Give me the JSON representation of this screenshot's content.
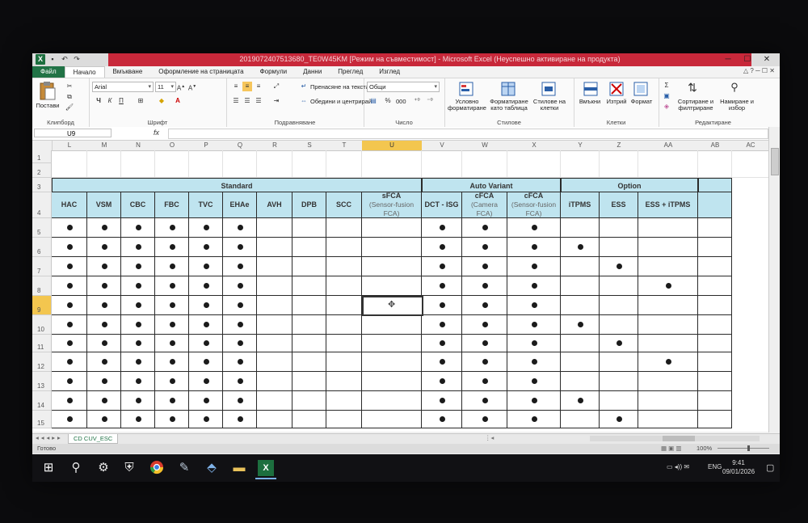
{
  "window": {
    "title": "2019072407513680_TE0W45KM [Режим на съвместимост] - Microsoft Excel (Неуспешно активиране на продукта)",
    "quick_access": [
      "save-icon",
      "undo-icon",
      "redo-icon"
    ],
    "controls": [
      "─",
      "☐",
      "✕"
    ]
  },
  "ribbon_tabs": [
    "Файл",
    "Начало",
    "Вмъкване",
    "Оформление на страницата",
    "Формули",
    "Данни",
    "Преглед",
    "Изглед"
  ],
  "ribbon": {
    "clipboard": {
      "paste": "Постави",
      "label": "Клипборд"
    },
    "font": {
      "name": "Arial",
      "size": "11",
      "label": "Шрифт",
      "bold": "Ч",
      "italic": "К",
      "underline": "П"
    },
    "alignment": {
      "wrap": "Пренасяне на текста",
      "merge": "Обедини и центрирай",
      "label": "Подравняване"
    },
    "number": {
      "format": "Общи",
      "label": "Число",
      "percent": "%",
      "thousands": "000"
    },
    "styles": {
      "cond": "Условно форматиране",
      "table": "Форматиране като таблица",
      "cell": "Стилове на клетки",
      "label": "Стилове"
    },
    "cells": {
      "insert": "Вмъкни",
      "delete": "Изтрий",
      "format": "Формат",
      "label": "Клетки"
    },
    "editing": {
      "sort": "Сортиране и филтриране",
      "find": "Намиране и избор",
      "label": "Редактиране",
      "sum": "Σ"
    }
  },
  "formula_bar": {
    "name_box": "U9",
    "fx": "fx",
    "content": ""
  },
  "columns": [
    "L",
    "M",
    "N",
    "O",
    "P",
    "Q",
    "R",
    "S",
    "T",
    "U",
    "V",
    "W",
    "X",
    "Y",
    "Z",
    "AA",
    "AB",
    "AC"
  ],
  "selected_column": "U",
  "rows": [
    "1",
    "2",
    "3",
    "4",
    "5",
    "6",
    "7",
    "8",
    "9",
    "10",
    "11",
    "12",
    "13",
    "14",
    "15"
  ],
  "selected_row": "9",
  "table": {
    "groups": [
      {
        "name": "Standard"
      },
      {
        "name": "Auto Variant"
      },
      {
        "name": "Option"
      }
    ],
    "headers": [
      {
        "label": "HAC"
      },
      {
        "label": "VSM"
      },
      {
        "label": "CBC"
      },
      {
        "label": "FBC"
      },
      {
        "label": "TVC"
      },
      {
        "label": "EHAe"
      },
      {
        "label": "AVH"
      },
      {
        "label": "DPB"
      },
      {
        "label": "SCC"
      },
      {
        "label": "sFCA",
        "sub": "(Sensor-fusion FCA)"
      },
      {
        "label": "DCT - ISG"
      },
      {
        "label": "cFCA",
        "sub": "(Camera FCA)"
      },
      {
        "label": "cFCA",
        "sub": "(Sensor-fusion FCA)"
      },
      {
        "label": "iTPMS"
      },
      {
        "label": "ESS"
      },
      {
        "label": "ESS + iTPMS"
      },
      {
        "label": ""
      }
    ],
    "marks": [
      [
        1,
        1,
        1,
        1,
        1,
        1,
        0,
        0,
        0,
        0,
        1,
        1,
        1,
        0,
        0,
        0,
        0
      ],
      [
        1,
        1,
        1,
        1,
        1,
        1,
        0,
        0,
        0,
        0,
        1,
        1,
        1,
        1,
        0,
        0,
        0
      ],
      [
        1,
        1,
        1,
        1,
        1,
        1,
        0,
        0,
        0,
        0,
        1,
        1,
        1,
        0,
        1,
        0,
        0
      ],
      [
        1,
        1,
        1,
        1,
        1,
        1,
        0,
        0,
        0,
        0,
        1,
        1,
        1,
        0,
        0,
        1,
        0
      ],
      [
        1,
        1,
        1,
        1,
        1,
        1,
        0,
        0,
        0,
        0,
        1,
        1,
        1,
        0,
        0,
        0,
        0
      ],
      [
        1,
        1,
        1,
        1,
        1,
        1,
        0,
        0,
        0,
        0,
        1,
        1,
        1,
        1,
        0,
        0,
        0
      ],
      [
        1,
        1,
        1,
        1,
        1,
        1,
        0,
        0,
        0,
        0,
        1,
        1,
        1,
        0,
        1,
        0,
        0
      ],
      [
        1,
        1,
        1,
        1,
        1,
        1,
        0,
        0,
        0,
        0,
        1,
        1,
        1,
        0,
        0,
        1,
        0
      ],
      [
        1,
        1,
        1,
        1,
        1,
        1,
        0,
        0,
        0,
        0,
        1,
        1,
        1,
        0,
        0,
        0,
        0
      ],
      [
        1,
        1,
        1,
        1,
        1,
        1,
        0,
        0,
        0,
        0,
        1,
        1,
        1,
        1,
        0,
        0,
        0
      ],
      [
        1,
        1,
        1,
        1,
        1,
        1,
        0,
        0,
        0,
        0,
        1,
        1,
        1,
        0,
        1,
        0,
        0
      ]
    ]
  },
  "sheet_tabs": {
    "active": "CD CUV_ESC"
  },
  "status": {
    "ready": "Готово",
    "zoom": "100%"
  },
  "taskbar": {
    "lang": "ENG",
    "time": "9:41",
    "date": "09/01/2026"
  }
}
